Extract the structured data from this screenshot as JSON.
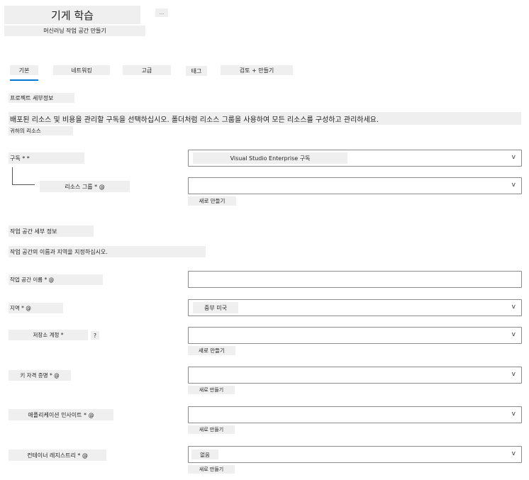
{
  "header": {
    "title": "기게 학습",
    "more_label": "...",
    "subtitle": "머신러닝 작업 공간 만들기"
  },
  "tabs": [
    {
      "label": "기본"
    },
    {
      "label": "네트워킹"
    },
    {
      "label": "고급"
    },
    {
      "label": "태그"
    },
    {
      "label": "검토 + 만들기"
    }
  ],
  "project": {
    "section_title": "프로젝트 세부정보",
    "description": "배포된 리소스 및 비용을 관리할 구독을 선택하십시오. 폴더처럼 리소스 그룹을 사용하여 모든 리소스를 구성하고 관리하세요.",
    "sub_label": "귀하의 리소스",
    "subscription_label": "구독 * *",
    "subscription_value": "Visual Studio Enterprise 구독",
    "resource_group_label": "리소스 그룹 * @",
    "resource_group_value": "",
    "create_new": "새로 만들기"
  },
  "workspace": {
    "section_title": "작업 공간 세부 정보",
    "description": "작업 공간의 이름과 지역을 지정하십시오.",
    "name_label": "작업 공간 이름 * @",
    "name_value": "",
    "region_label": "지역 * @",
    "region_value": "중부 미국",
    "storage_label": "저장소 계정 *",
    "storage_help": "?",
    "storage_value": "",
    "storage_create": "새로 만들기",
    "keyvault_label": "키 자격 증명 * @",
    "keyvault_value": "",
    "keyvault_create": "새로 만들기",
    "appinsights_label": "애플리케이션 인사이트 * @",
    "appinsights_value": "",
    "appinsights_create": "새로 만들기",
    "registry_label": "컨테이너 레지스트리 * @",
    "registry_value": "없음",
    "registry_create": "새로 만들기"
  },
  "icons": {
    "dropdown": "chevron-down-icon",
    "chevron_glyph": "v"
  },
  "colors": {
    "tab_underline": "#0078d4",
    "field_border": "#8a8a8a",
    "chip_bg": "#efefef"
  }
}
